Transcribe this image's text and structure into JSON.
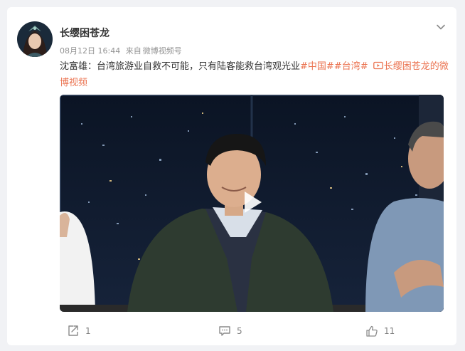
{
  "post": {
    "author": "长缨困苍龙",
    "date": "08月12日 16:44",
    "source_prefix": "来自",
    "source": "微博视频号",
    "text": "沈富雄：台湾旅游业自救不可能，只有陆客能救台湾观光业",
    "hashtag_1": "#中国#",
    "hashtag_2": "#台湾#",
    "video_link": "长缨困苍龙的微博视频"
  },
  "actions": {
    "repost_count": "1",
    "comment_count": "5",
    "like_count": "11"
  },
  "colors": {
    "link": "#eb7350",
    "text": "#333333",
    "meta": "#939393"
  },
  "icons": {
    "more": "chevron-down-icon",
    "repost": "share-icon",
    "comment": "comment-icon",
    "like": "thumbs-up-icon",
    "video": "video-link-icon",
    "play": "play-icon"
  }
}
